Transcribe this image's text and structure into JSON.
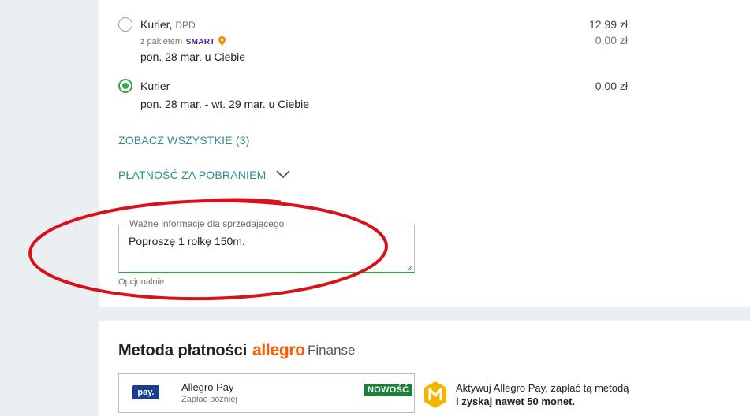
{
  "delivery": {
    "options": [
      {
        "carrier": "Kurier,",
        "carrier_detail": "DPD",
        "package_prefix": "z pakietem",
        "package_brand": "SMART",
        "date": "pon. 28 mar. u Ciebie",
        "price": "12,99 zł",
        "price_discounted": "0,00 zł",
        "selected": false
      },
      {
        "carrier": "Kurier",
        "date": "pon. 28 mar. - wt. 29 mar. u Ciebie",
        "price": "0,00 zł",
        "selected": true
      }
    ],
    "show_all_link": "ZOBACZ WSZYSTKIE (3)",
    "cod_toggle": "PŁATNOŚĆ ZA POBRANIEM"
  },
  "seller_note": {
    "label": "Ważne informacje dla sprzedającego",
    "value": "Poproszę 1 rolkę 150m.",
    "helper": "Opcjonalnie"
  },
  "payment": {
    "title": "Metoda płatności",
    "brand_logo": "allegro",
    "brand_suffix": "Finanse",
    "option": {
      "badge": "pay.",
      "name": "Allegro Pay",
      "subtitle": "Zapłać później",
      "new_label": "NOWOŚĆ"
    },
    "promo": {
      "line1": "Aktywuj Allegro Pay, zapłać tą metodą",
      "line2": "i zyskaj nawet 50 monet."
    }
  },
  "colors": {
    "accent_green": "#35a54a",
    "link_teal": "#2c8f87",
    "annotation_red": "#d8121b",
    "allegro_orange": "#ff5a00",
    "smart_purple": "#4a2a8a",
    "coin_yellow": "#f5b400"
  },
  "icons": {
    "smart_pin": "location-pin-icon",
    "cod_chevron": "chevron-down-icon",
    "coin": "monety-coin-icon"
  }
}
